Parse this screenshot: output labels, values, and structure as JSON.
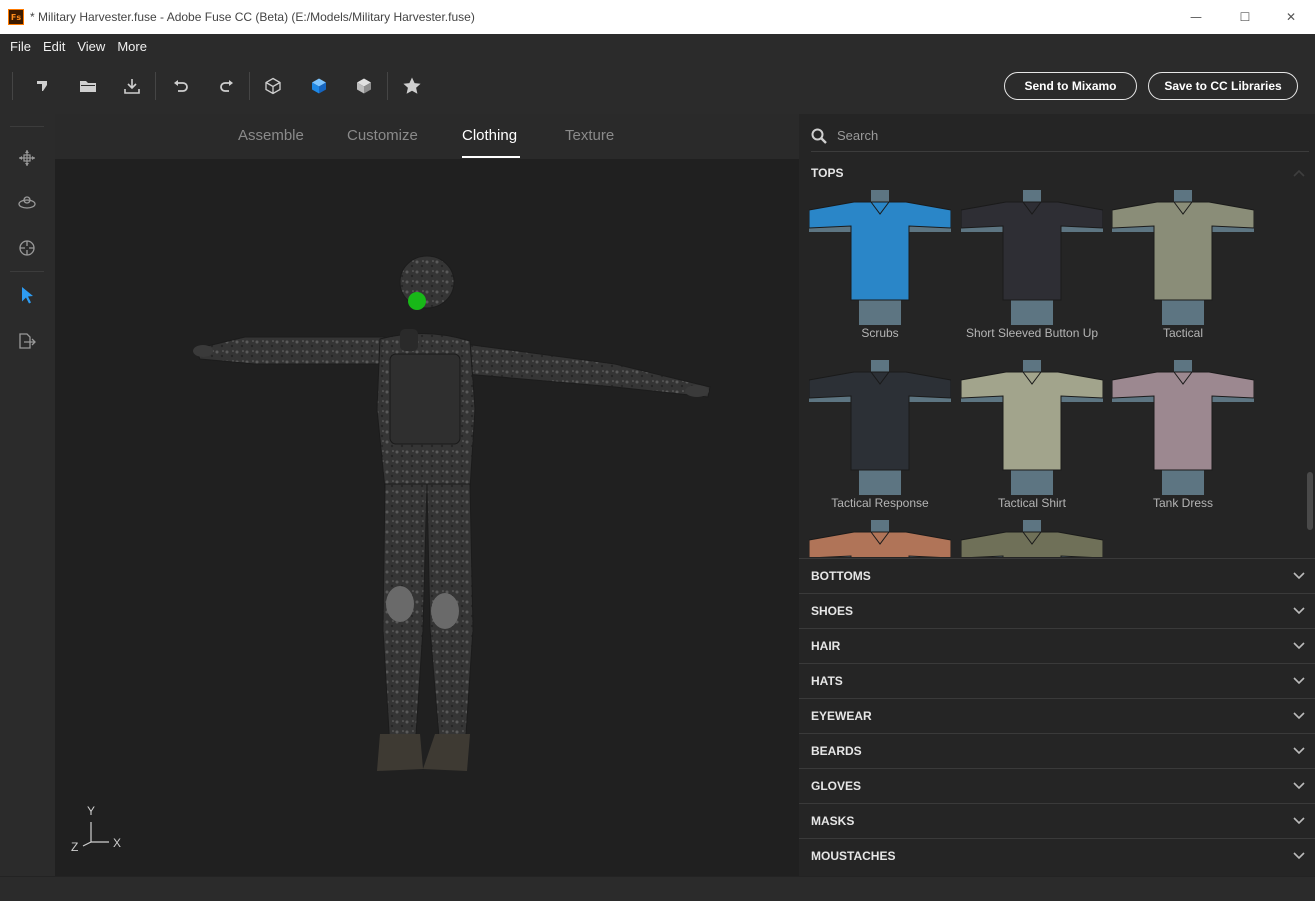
{
  "window": {
    "title": "* Military Harvester.fuse - Adobe Fuse CC (Beta) (E:/Models/Military Harvester.fuse)",
    "app_badge": "Fs",
    "minimize": "—",
    "maximize": "☐",
    "close": "✕"
  },
  "menu": [
    "File",
    "Edit",
    "View",
    "More"
  ],
  "toolbar": {
    "send_to_mixamo": "Send to Mixamo",
    "save_to_cc": "Save to CC Libraries"
  },
  "tabs": [
    {
      "label": "Assemble",
      "active": false
    },
    {
      "label": "Customize",
      "active": false
    },
    {
      "label": "Clothing",
      "active": true
    },
    {
      "label": "Texture",
      "active": false
    }
  ],
  "axis": {
    "y": "Y",
    "x": "X",
    "z": "Z"
  },
  "search": {
    "placeholder": "Search"
  },
  "categories": {
    "expanded": "TOPS",
    "collapsed": [
      "BOTTOMS",
      "SHOES",
      "HAIR",
      "HATS",
      "EYEWEAR",
      "BEARDS",
      "GLOVES",
      "MASKS",
      "MOUSTACHES"
    ]
  },
  "tops": [
    {
      "label": "Scrubs",
      "color": "#2a86c8"
    },
    {
      "label": "Short Sleeved Button Up",
      "color": "#2e2e34"
    },
    {
      "label": "Tactical",
      "color": "#8a8d78"
    },
    {
      "label": "Tactical Response",
      "color": "#2c3036"
    },
    {
      "label": "Tactical Shirt",
      "color": "#a2a48c"
    },
    {
      "label": "Tank Dress",
      "color": "#9c8890"
    },
    {
      "label": "",
      "color": "#b07458"
    },
    {
      "label": "",
      "color": "#6f7058"
    }
  ],
  "colors": {
    "accent": "#2e9cf2",
    "mannequin": "#5d7582"
  }
}
